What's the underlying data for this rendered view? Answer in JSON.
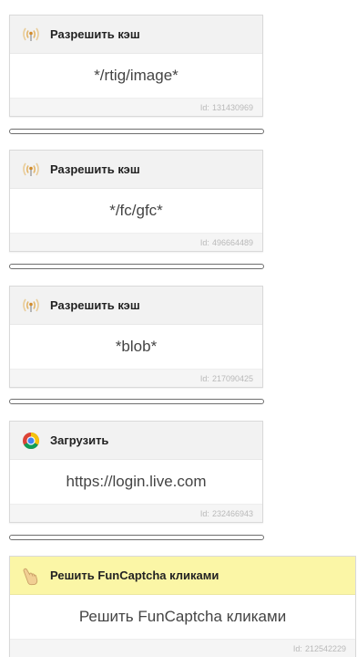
{
  "blocks": [
    {
      "icon": "signal-antenna-icon",
      "title": "Разрешить кэш",
      "content": "*/rtig/image*",
      "id_label": "Id:",
      "id_value": "131430969"
    },
    {
      "icon": "signal-antenna-icon",
      "title": "Разрешить кэш",
      "content": "*/fc/gfc*",
      "id_label": "Id:",
      "id_value": "496664489"
    },
    {
      "icon": "signal-antenna-icon",
      "title": "Разрешить кэш",
      "content": "*blob*",
      "id_label": "Id:",
      "id_value": "217090425"
    },
    {
      "icon": "chrome-icon",
      "title": "Загрузить",
      "content": "https://login.live.com",
      "id_label": "Id:",
      "id_value": "232466943"
    },
    {
      "icon": "pointing-hand-icon",
      "title": "Решить FunCaptcha кликами",
      "content": "Решить FunCaptcha кликами",
      "id_label": "Id:",
      "id_value": "212542229"
    }
  ],
  "colors": {
    "header_default": "#f2f2f2",
    "header_highlight": "#fbf6a6",
    "id_text": "#b9b9b9",
    "antenna": "#e3b66a"
  }
}
